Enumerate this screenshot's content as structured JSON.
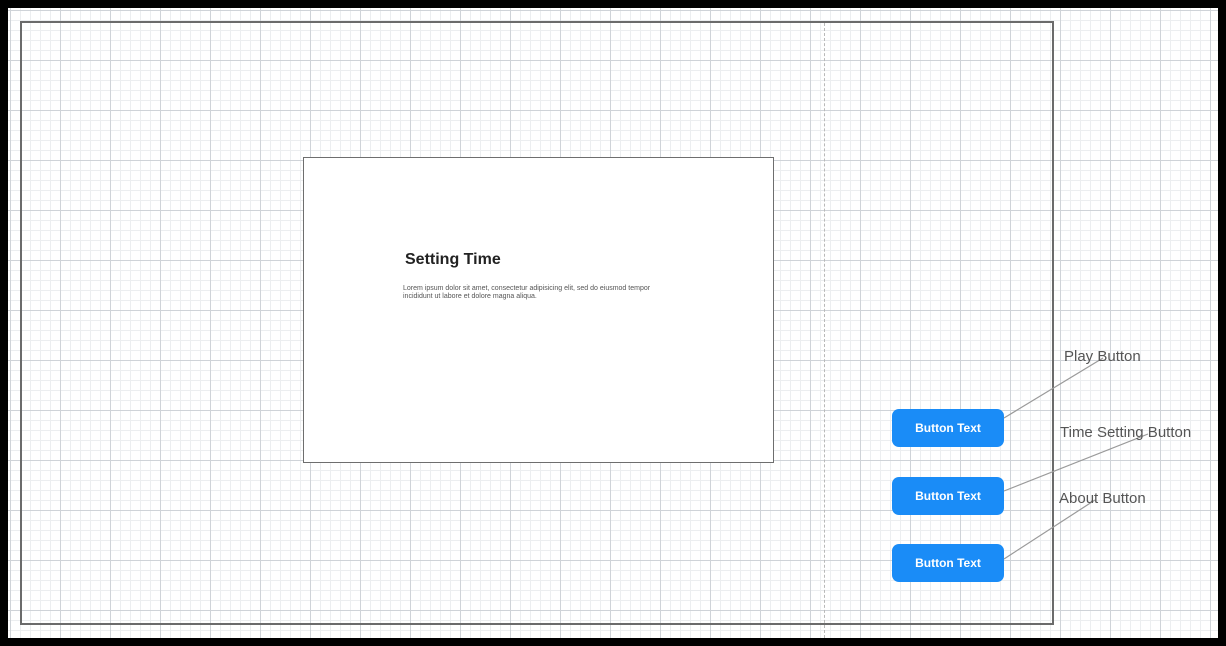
{
  "panel": {
    "title": "Setting Time",
    "body": "Lorem ipsum dolor sit amet, consectetur adipisicing elit, sed do eiusmod tempor incididunt ut labore et dolore magna aliqua."
  },
  "buttons": [
    {
      "label": "Button Text",
      "callout": "Play Button"
    },
    {
      "label": "Button Text",
      "callout": "Time Setting Button"
    },
    {
      "label": "Button Text",
      "callout": "About Button"
    }
  ],
  "colors": {
    "button": "#1a8cf7",
    "button_text": "#ffffff",
    "callout_text": "#555555",
    "border": "#000000"
  }
}
